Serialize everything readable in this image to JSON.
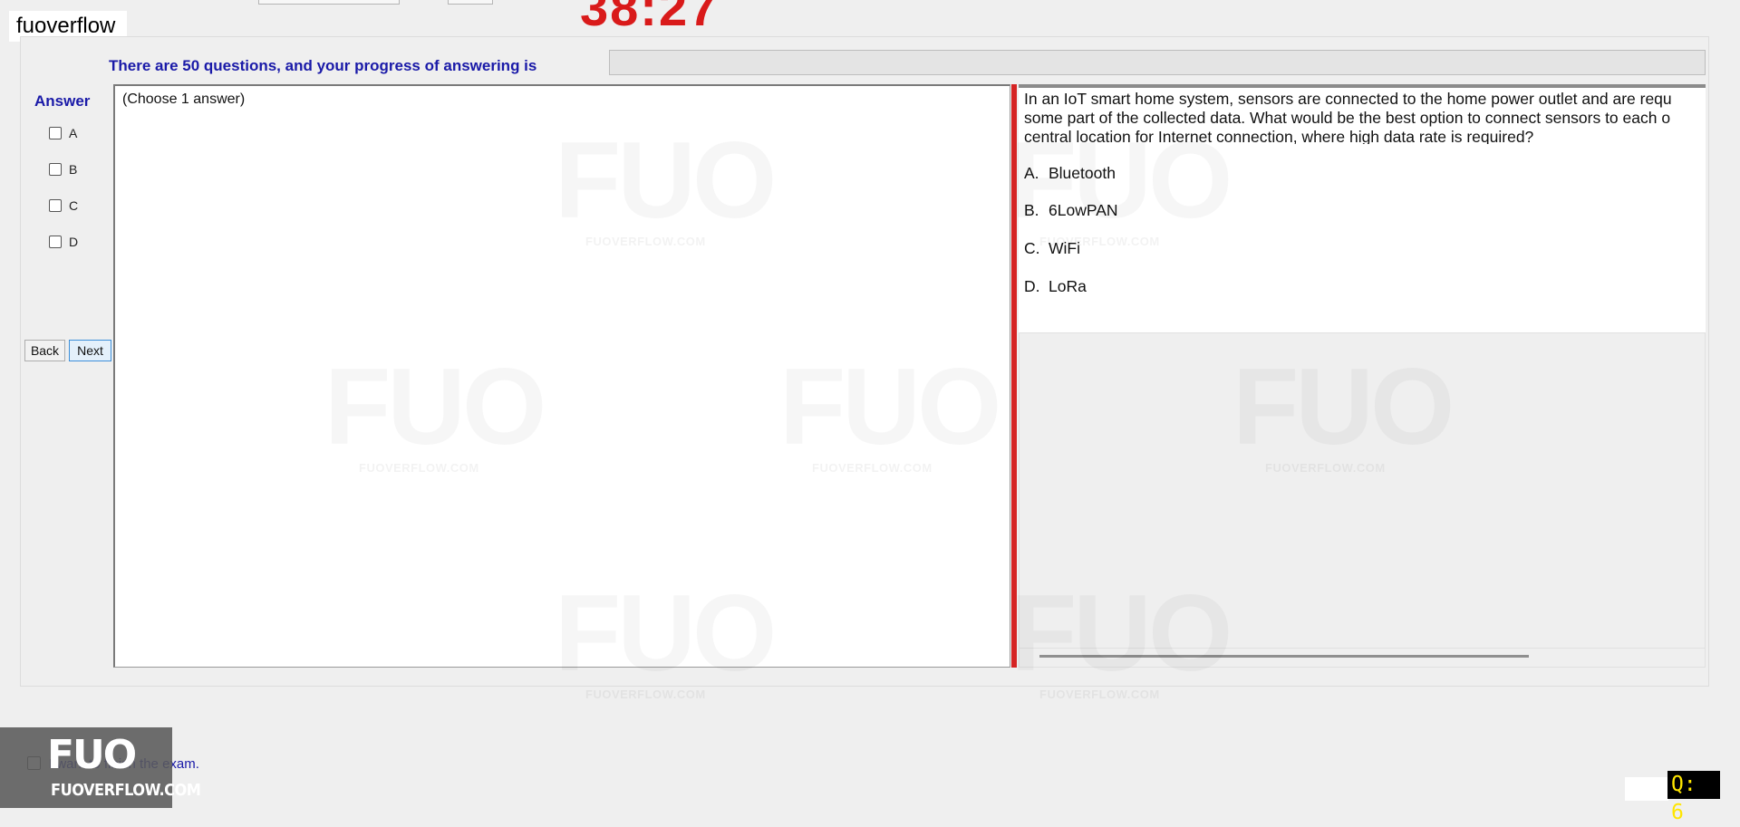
{
  "brand": {
    "text": "fuoverflow"
  },
  "timer": {
    "text": "38:27"
  },
  "progress": {
    "text": "There are 50 questions, and your progress of answering is",
    "value": 0
  },
  "answer_panel": {
    "title": "Answer",
    "options": [
      {
        "label": "A",
        "checked": false
      },
      {
        "label": "B",
        "checked": false
      },
      {
        "label": "C",
        "checked": false
      },
      {
        "label": "D",
        "checked": false
      }
    ]
  },
  "nav": {
    "back_label": "Back",
    "next_label": "Next"
  },
  "left_pane": {
    "instruction": "(Choose 1 answer)"
  },
  "question": {
    "lines": [
      "In an IoT smart home system, sensors are connected to the home power outlet and are requ",
      "some part of the collected data. What would be the best option to connect sensors to each o",
      "central location for Internet connection, where high data rate is required?"
    ],
    "options": [
      {
        "letter": "A.",
        "text": "Bluetooth"
      },
      {
        "letter": "B.",
        "text": "6LowPAN"
      },
      {
        "letter": "C.",
        "text": "WiFi"
      },
      {
        "letter": "D.",
        "text": "LoRa"
      }
    ]
  },
  "footer": {
    "finish_text": "I want to finish the exam.",
    "logo_mark": "FUO",
    "logo_site": "FUOVERFLOW.COM",
    "question_badge": "Q: 6"
  },
  "watermark": {
    "mark": "FUO",
    "site": "FUOVERFLOW.COM"
  },
  "colors": {
    "timer": "#d91a1a",
    "heading": "#1a1aa8",
    "splitter": "#d52424",
    "badge_text": "#ffe600"
  }
}
